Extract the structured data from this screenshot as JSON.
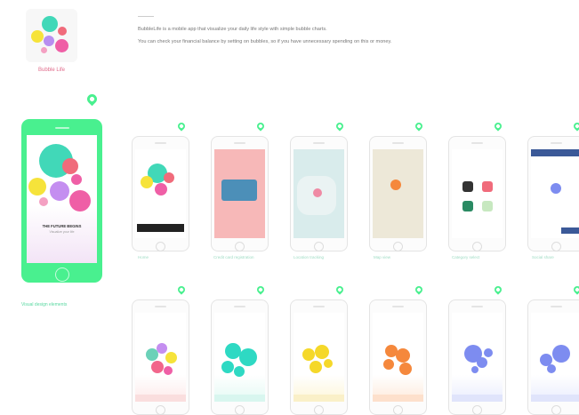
{
  "app": {
    "logo_caption": "Bubble Life",
    "logo_colors": [
      "#ef5fa6",
      "#f6e33a",
      "#b88ef0",
      "#41d8b8",
      "#f06b7b"
    ]
  },
  "description": {
    "line1": "BubbleLife is a mobile app that visualize your daily life style with simple bubble charts.",
    "line2": "You can check your financial balance by setting on bubbles, so if you have unnecessary spending on this or money."
  },
  "accent": "#49f08f",
  "hero": {
    "title": "THE FUTURE BEGINS",
    "subtitle": "Visualize your life",
    "caption": "Visual design elements"
  },
  "screens_row1": [
    {
      "caption": "Home",
      "icon": "onboarding-bubbles"
    },
    {
      "caption": "Credit card registration",
      "icon": "credit-card"
    },
    {
      "caption": "Location tracking",
      "icon": "map-pin"
    },
    {
      "caption": "Map view",
      "icon": "map"
    },
    {
      "caption": "Category select",
      "icon": "category-grid"
    },
    {
      "caption": "Social share",
      "icon": "social-share"
    }
  ],
  "screens_row2": [
    {
      "caption": "",
      "theme": "#f2668b"
    },
    {
      "caption": "",
      "theme": "#2ed9c3"
    },
    {
      "caption": "",
      "theme": "#f5d829"
    },
    {
      "caption": "",
      "theme": "#f5883c"
    },
    {
      "caption": "",
      "theme": "#7d8cf0"
    },
    {
      "caption": "",
      "theme": "#7d8cf0"
    }
  ]
}
